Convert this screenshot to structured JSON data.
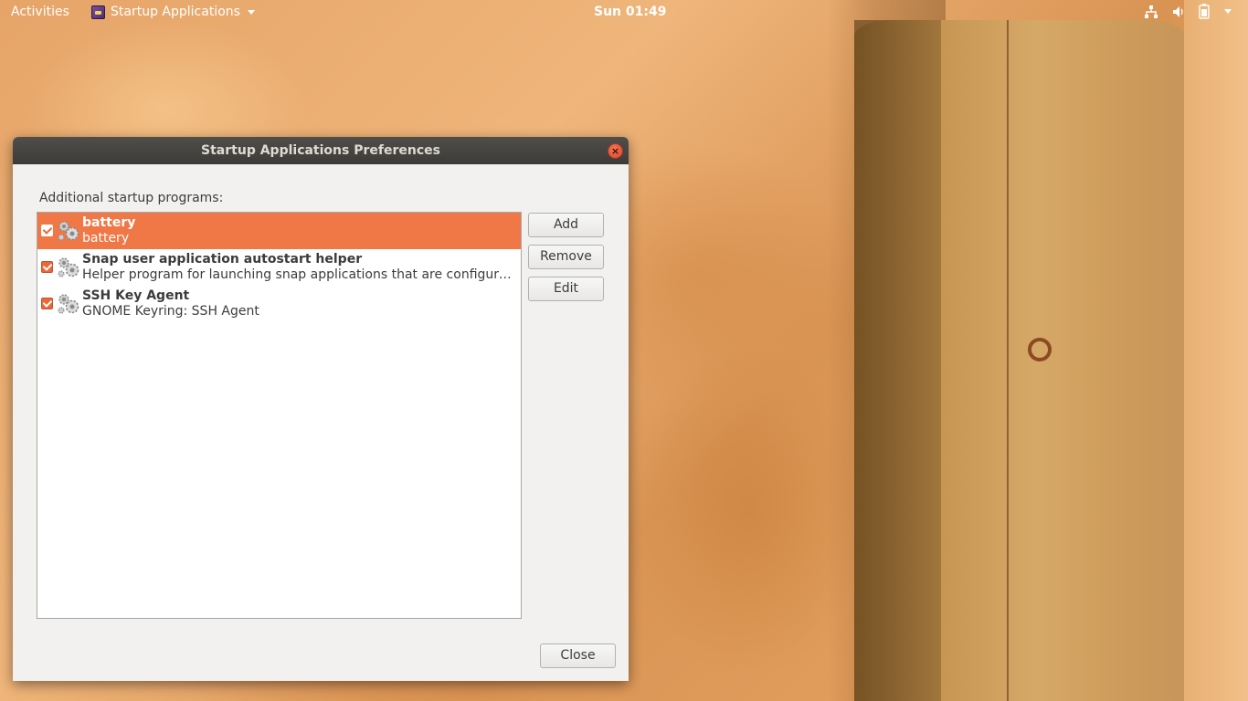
{
  "topbar": {
    "activities": "Activities",
    "app_menu": "Startup Applications",
    "clock": "Sun 01:49",
    "tray_icons": [
      "network-icon",
      "volume-icon",
      "battery-icon",
      "chevron-down-icon"
    ]
  },
  "dialog": {
    "title": "Startup Applications Preferences",
    "section_label": "Additional startup programs:",
    "programs": [
      {
        "name": "battery",
        "description": "battery",
        "enabled": true,
        "selected": true
      },
      {
        "name": "Snap user application autostart helper",
        "description": "Helper program for launching snap applications that are configured to start automatically.",
        "enabled": true,
        "selected": false
      },
      {
        "name": "SSH Key Agent",
        "description": "GNOME Keyring: SSH Agent",
        "enabled": true,
        "selected": false
      }
    ],
    "buttons": {
      "add": "Add",
      "remove": "Remove",
      "edit": "Edit",
      "close": "Close"
    }
  },
  "colors": {
    "accent": "#f07746",
    "titlebar": "#3d3b38",
    "dialog_bg": "#f2f1f0"
  }
}
